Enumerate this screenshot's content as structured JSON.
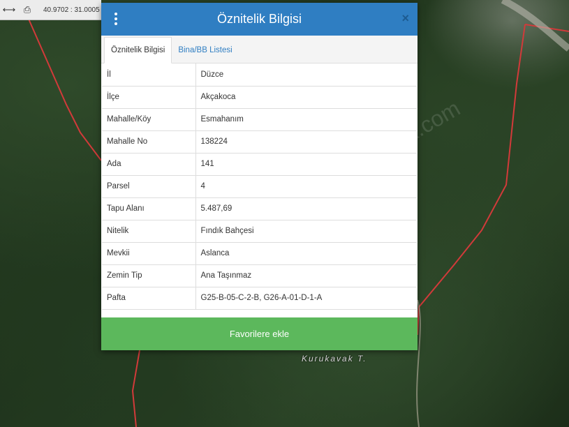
{
  "toolbar": {
    "coordinates": "40.9702 : 31.0005",
    "icons": [
      "measure-icon",
      "print-icon"
    ]
  },
  "map": {
    "place_label": "Kurukavak T.",
    "watermark": "ak.com"
  },
  "dialog": {
    "title": "Öznitelik Bilgisi",
    "close_label": "×",
    "tabs": [
      {
        "label": "Öznitelik Bilgisi",
        "active": true
      },
      {
        "label": "Bina/BB Listesi",
        "active": false
      }
    ],
    "rows": [
      {
        "key": "İl",
        "value": "Düzce"
      },
      {
        "key": "İlçe",
        "value": "Akçakoca"
      },
      {
        "key": "Mahalle/Köy",
        "value": "Esmahanım"
      },
      {
        "key": "Mahalle No",
        "value": "138224"
      },
      {
        "key": "Ada",
        "value": "141"
      },
      {
        "key": "Parsel",
        "value": "4"
      },
      {
        "key": "Tapu Alanı",
        "value": "5.487,69"
      },
      {
        "key": "Nitelik",
        "value": "Fındık Bahçesi"
      },
      {
        "key": "Mevkii",
        "value": "Aslanca"
      },
      {
        "key": "Zemin Tip",
        "value": "Ana Taşınmaz"
      },
      {
        "key": "Pafta",
        "value": "G25-B-05-C-2-B, G26-A-01-D-1-A"
      }
    ],
    "favorite_button": "Favorilere ekle"
  },
  "colors": {
    "header": "#2f7ec2",
    "favorite_button": "#5cb85c",
    "parcel_boundary": "#d23a3a"
  }
}
